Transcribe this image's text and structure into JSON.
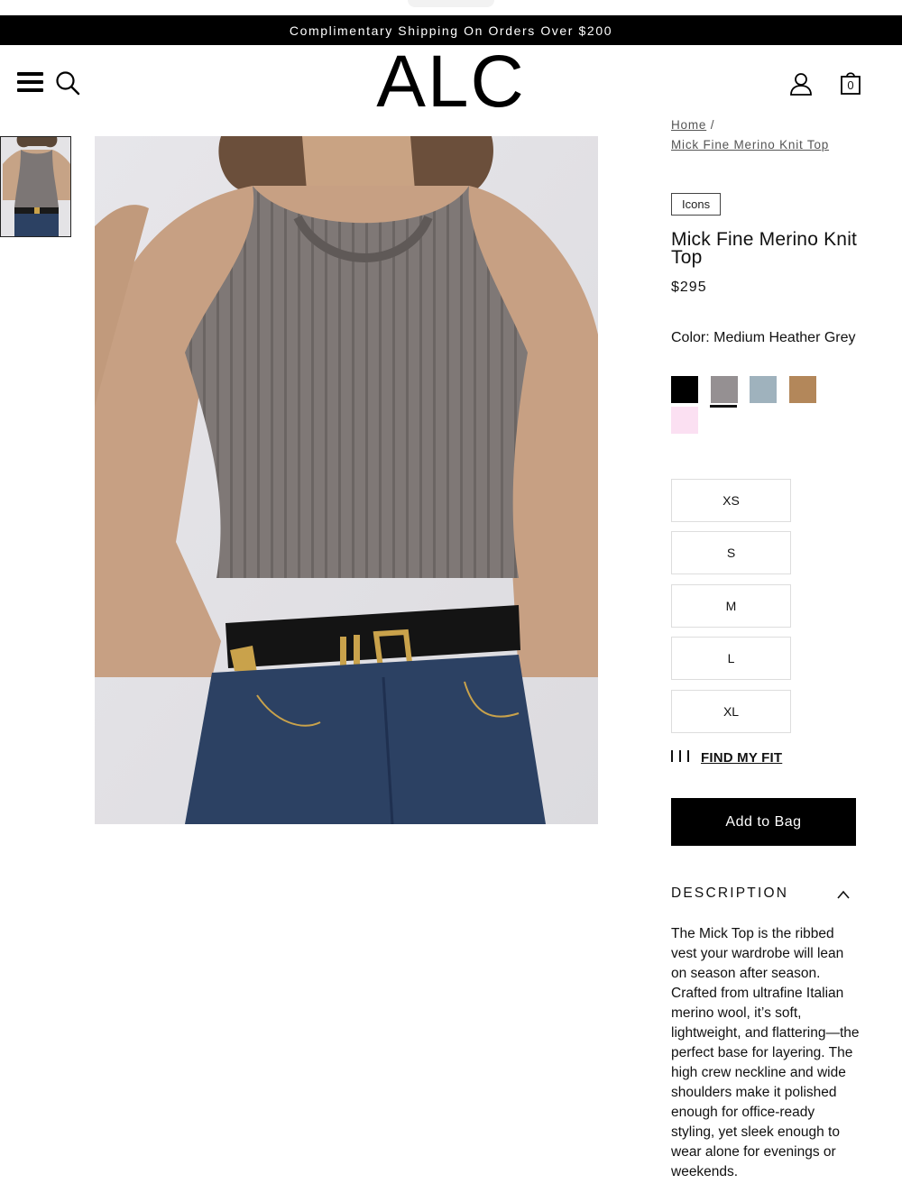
{
  "promo": {
    "text": "Complimentary Shipping On Orders Over $200"
  },
  "header": {
    "logo": "ALC",
    "menu_icon": "hamburger-menu-icon",
    "search_icon": "search-icon",
    "account_icon": "user-account-icon",
    "bag_icon": "shopping-bag-icon",
    "bag_count": "0"
  },
  "breadcrumb": {
    "home": "Home",
    "separator": "/",
    "current": "Mick Fine Merino Knit Top"
  },
  "product": {
    "badge": "Icons",
    "title": "Mick Fine Merino Knit Top",
    "price": "$295",
    "color_label": "Color: Medium Heather Grey",
    "swatches": [
      {
        "color": "#000000"
      },
      {
        "color": "#959092",
        "selected": true
      },
      {
        "color": "#9fb2bd"
      },
      {
        "color": "#b3875a"
      },
      {
        "color": "#fbe0f2"
      }
    ],
    "sizes": [
      "XS",
      "S",
      "M",
      "L",
      "XL"
    ],
    "fit_label": "FIND MY FIT",
    "add_to_bag": "Add to Bag"
  },
  "description": {
    "heading": "DESCRIPTION",
    "text": "The Mick Top is the ribbed vest your wardrobe will lean on season after season. Crafted from ultrafine Italian merino wool, it’s soft, lightweight, and flattering—the perfect base for layering. The high crew neckline and wide shoulders make it polished enough for office-ready styling, yet sleek enough to wear alone for evenings or weekends."
  }
}
